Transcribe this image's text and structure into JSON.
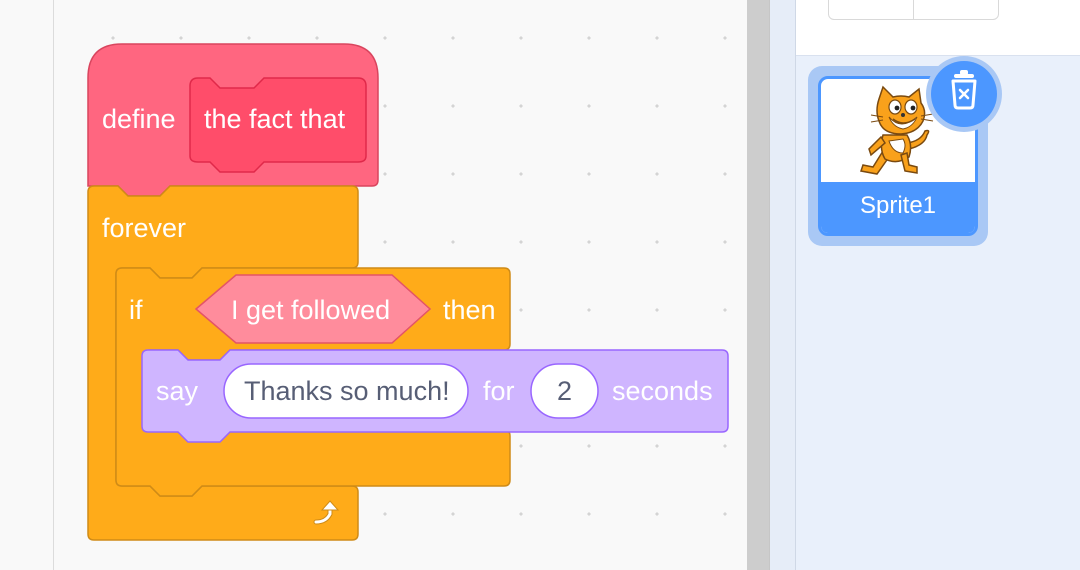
{
  "code_area": {
    "define_block": {
      "keyword": "define",
      "custom_name": "the fact that"
    },
    "forever_block": {
      "keyword": "forever"
    },
    "if_block": {
      "keyword_if": "if",
      "condition": "I get followed",
      "keyword_then": "then"
    },
    "say_block": {
      "keyword_say": "say",
      "message": "Thanks so much!",
      "keyword_for": "for",
      "seconds": "2",
      "keyword_seconds": "seconds"
    }
  },
  "sprite_pane": {
    "selected_sprite": {
      "name": "Sprite1",
      "thumbnail_icon": "scratch-cat-icon"
    },
    "delete_icon": "trash-delete-icon"
  },
  "colors": {
    "define_block": "#ff6680",
    "define_inner": "#ff4d6a",
    "control_block": "#ffab19",
    "control_border": "#cf8b17",
    "looks_block": "#cfb5ff",
    "looks_border": "#9966ff",
    "operator_pink": "#ff8c9c",
    "accent_blue": "#4c97ff"
  }
}
